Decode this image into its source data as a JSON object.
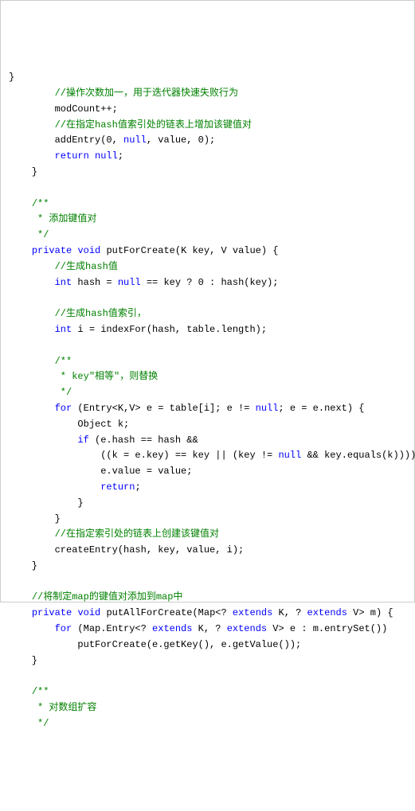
{
  "lines": [
    {
      "segs": [
        {
          "t": "}",
          "c": ""
        }
      ]
    },
    {
      "segs": [
        {
          "t": "        ",
          "c": ""
        },
        {
          "t": "//操作次数加一，用于迭代器快速失败行为",
          "c": "cm"
        }
      ]
    },
    {
      "segs": [
        {
          "t": "        modCount++;",
          "c": ""
        }
      ]
    },
    {
      "segs": [
        {
          "t": "        ",
          "c": ""
        },
        {
          "t": "//在指定hash值索引处的链表上增加该键值对",
          "c": "cm"
        }
      ]
    },
    {
      "segs": [
        {
          "t": "        addEntry(",
          "c": ""
        },
        {
          "t": "0",
          "c": ""
        },
        {
          "t": ", ",
          "c": ""
        },
        {
          "t": "null",
          "c": "kw"
        },
        {
          "t": ", value, ",
          "c": ""
        },
        {
          "t": "0",
          "c": ""
        },
        {
          "t": ");",
          "c": ""
        }
      ]
    },
    {
      "segs": [
        {
          "t": "        ",
          "c": ""
        },
        {
          "t": "return",
          "c": "kw"
        },
        {
          "t": " ",
          "c": ""
        },
        {
          "t": "null",
          "c": "kw"
        },
        {
          "t": ";",
          "c": ""
        }
      ]
    },
    {
      "segs": [
        {
          "t": "    }",
          "c": ""
        }
      ]
    },
    {
      "segs": [
        {
          "t": " ",
          "c": ""
        }
      ]
    },
    {
      "segs": [
        {
          "t": "    ",
          "c": ""
        },
        {
          "t": "/**",
          "c": "cm"
        }
      ]
    },
    {
      "segs": [
        {
          "t": "     * 添加键值对",
          "c": "cm"
        }
      ]
    },
    {
      "segs": [
        {
          "t": "     */",
          "c": "cm"
        }
      ]
    },
    {
      "segs": [
        {
          "t": "    ",
          "c": ""
        },
        {
          "t": "private",
          "c": "kw"
        },
        {
          "t": " ",
          "c": ""
        },
        {
          "t": "void",
          "c": "kw"
        },
        {
          "t": " putForCreate(K key, V value) {",
          "c": ""
        }
      ]
    },
    {
      "segs": [
        {
          "t": "        ",
          "c": ""
        },
        {
          "t": "//生成hash值",
          "c": "cm"
        }
      ]
    },
    {
      "segs": [
        {
          "t": "        ",
          "c": ""
        },
        {
          "t": "int",
          "c": "kw"
        },
        {
          "t": " hash = ",
          "c": ""
        },
        {
          "t": "null",
          "c": "kw"
        },
        {
          "t": " == key ? ",
          "c": ""
        },
        {
          "t": "0",
          "c": ""
        },
        {
          "t": " : hash(key);",
          "c": ""
        }
      ]
    },
    {
      "segs": [
        {
          "t": " ",
          "c": ""
        }
      ]
    },
    {
      "segs": [
        {
          "t": "        ",
          "c": ""
        },
        {
          "t": "//生成hash值索引，",
          "c": "cm"
        }
      ]
    },
    {
      "segs": [
        {
          "t": "        ",
          "c": ""
        },
        {
          "t": "int",
          "c": "kw"
        },
        {
          "t": " i = indexFor(hash, table.length);",
          "c": ""
        }
      ]
    },
    {
      "segs": [
        {
          "t": " ",
          "c": ""
        }
      ]
    },
    {
      "segs": [
        {
          "t": "        ",
          "c": ""
        },
        {
          "t": "/**",
          "c": "cm"
        }
      ]
    },
    {
      "segs": [
        {
          "t": "         * key\"相等\"，则替换",
          "c": "cm"
        }
      ]
    },
    {
      "segs": [
        {
          "t": "         */",
          "c": "cm"
        }
      ]
    },
    {
      "segs": [
        {
          "t": "        ",
          "c": ""
        },
        {
          "t": "for",
          "c": "kw"
        },
        {
          "t": " (Entry<K,V> e = table[i]; e != ",
          "c": ""
        },
        {
          "t": "null",
          "c": "kw"
        },
        {
          "t": "; e = e.next) {",
          "c": ""
        }
      ]
    },
    {
      "segs": [
        {
          "t": "            Object k;",
          "c": ""
        }
      ]
    },
    {
      "segs": [
        {
          "t": "            ",
          "c": ""
        },
        {
          "t": "if",
          "c": "kw"
        },
        {
          "t": " (e.hash == hash &&",
          "c": ""
        }
      ]
    },
    {
      "segs": [
        {
          "t": "                ((k = e.key) == key || (key != ",
          "c": ""
        },
        {
          "t": "null",
          "c": "kw"
        },
        {
          "t": " && key.equals(k)))) {",
          "c": ""
        }
      ]
    },
    {
      "segs": [
        {
          "t": "                e.value = value;",
          "c": ""
        }
      ]
    },
    {
      "segs": [
        {
          "t": "                ",
          "c": ""
        },
        {
          "t": "return",
          "c": "kw"
        },
        {
          "t": ";",
          "c": ""
        }
      ]
    },
    {
      "segs": [
        {
          "t": "            }",
          "c": ""
        }
      ]
    },
    {
      "segs": [
        {
          "t": "        }",
          "c": ""
        }
      ]
    },
    {
      "segs": [
        {
          "t": "        ",
          "c": ""
        },
        {
          "t": "//在指定索引处的链表上创建该键值对",
          "c": "cm"
        }
      ]
    },
    {
      "segs": [
        {
          "t": "        createEntry(hash, key, value, i);",
          "c": ""
        }
      ]
    },
    {
      "segs": [
        {
          "t": "    }",
          "c": ""
        }
      ]
    },
    {
      "segs": [
        {
          "t": " ",
          "c": ""
        }
      ]
    },
    {
      "segs": [
        {
          "t": "    ",
          "c": ""
        },
        {
          "t": "//将制定map的键值对添加到map中",
          "c": "cm"
        }
      ]
    },
    {
      "segs": [
        {
          "t": "    ",
          "c": ""
        },
        {
          "t": "private",
          "c": "kw"
        },
        {
          "t": " ",
          "c": ""
        },
        {
          "t": "void",
          "c": "kw"
        },
        {
          "t": " putAllForCreate(Map<? ",
          "c": ""
        },
        {
          "t": "extends",
          "c": "kw"
        },
        {
          "t": " K, ? ",
          "c": ""
        },
        {
          "t": "extends",
          "c": "kw"
        },
        {
          "t": " V> m) {",
          "c": ""
        }
      ]
    },
    {
      "segs": [
        {
          "t": "        ",
          "c": ""
        },
        {
          "t": "for",
          "c": "kw"
        },
        {
          "t": " (Map.Entry<? ",
          "c": ""
        },
        {
          "t": "extends",
          "c": "kw"
        },
        {
          "t": " K, ? ",
          "c": ""
        },
        {
          "t": "extends",
          "c": "kw"
        },
        {
          "t": " V> e : m.entrySet())",
          "c": ""
        }
      ]
    },
    {
      "segs": [
        {
          "t": "            putForCreate(e.getKey(), e.getValue());",
          "c": ""
        }
      ]
    },
    {
      "segs": [
        {
          "t": "    }",
          "c": ""
        }
      ]
    },
    {
      "segs": [
        {
          "t": " ",
          "c": ""
        }
      ]
    },
    {
      "segs": [
        {
          "t": "    ",
          "c": ""
        },
        {
          "t": "/**",
          "c": "cm"
        }
      ]
    },
    {
      "segs": [
        {
          "t": "     * 对数组扩容",
          "c": "cm"
        }
      ]
    },
    {
      "segs": [
        {
          "t": "     */",
          "c": "cm"
        }
      ]
    }
  ]
}
